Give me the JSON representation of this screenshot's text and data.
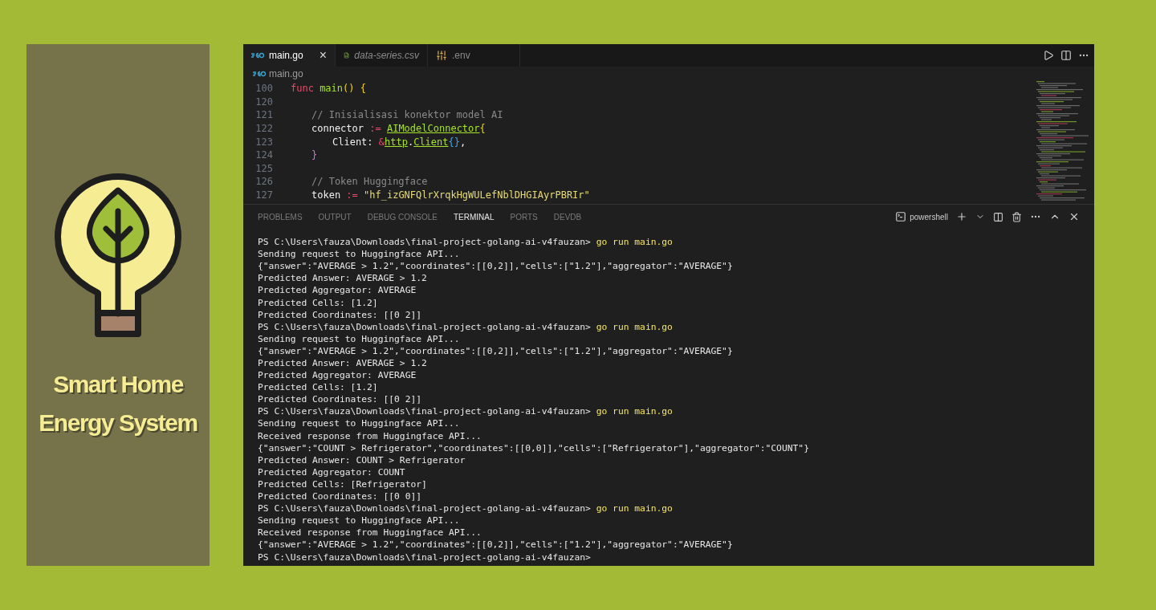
{
  "poster": {
    "title_lines": [
      "Smart Home",
      "Energy System"
    ]
  },
  "editor": {
    "tabs": [
      {
        "label": "main.go",
        "kind": "go",
        "selected": true,
        "italic": false,
        "close": "×"
      },
      {
        "label": "data-series.csv",
        "kind": "csv",
        "selected": false,
        "italic": true
      },
      {
        "label": ".env",
        "kind": "env",
        "selected": false,
        "italic": false
      }
    ],
    "breadcrumb": "main.go",
    "code_lines": [
      {
        "number": "100",
        "kind": "top",
        "tokens": [
          {
            "text": "func ",
            "kind": "keyword"
          },
          {
            "text": "main",
            "kind": "func"
          },
          {
            "text": "() {",
            "kind": "bracket"
          }
        ]
      },
      {
        "number": "120",
        "kind": "body"
      },
      {
        "number": "121",
        "kind": "body",
        "tokens": [
          {
            "text": "// Inisialisasi konektor model AI",
            "kind": "comment"
          }
        ]
      },
      {
        "number": "122",
        "kind": "body",
        "tokens": [
          {
            "text": "connector",
            "kind": "plain"
          },
          {
            "text": " := ",
            "kind": "op"
          },
          {
            "text": "AIModelConnector",
            "kind": "type"
          },
          {
            "text": "{",
            "kind": "bracket"
          }
        ]
      },
      {
        "number": "123",
        "kind": "inner",
        "tokens": [
          {
            "text": "Client: ",
            "kind": "plain"
          },
          {
            "text": "&",
            "kind": "op"
          },
          {
            "text": "http",
            "kind": "type"
          },
          {
            "text": ".",
            "kind": "plain"
          },
          {
            "text": "Client",
            "kind": "type"
          },
          {
            "text": "{}",
            "kind": "brace2"
          },
          {
            "text": ",",
            "kind": "plain"
          }
        ]
      },
      {
        "number": "124",
        "kind": "body",
        "tokens": [
          {
            "text": "}",
            "kind": "bracket3"
          }
        ]
      },
      {
        "number": "125",
        "kind": "body"
      },
      {
        "number": "126",
        "kind": "body",
        "tokens": [
          {
            "text": "// Token Huggingface",
            "kind": "comment"
          }
        ]
      },
      {
        "number": "127",
        "kind": "body",
        "tokens": [
          {
            "text": "token",
            "kind": "plain"
          },
          {
            "text": " := ",
            "kind": "op"
          },
          {
            "text": "\"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\"",
            "kind": "string"
          }
        ]
      }
    ]
  },
  "panel": {
    "tabs": [
      {
        "label": "PROBLEMS",
        "selected": false
      },
      {
        "label": "OUTPUT",
        "selected": false
      },
      {
        "label": "DEBUG CONSOLE",
        "selected": false
      },
      {
        "label": "TERMINAL",
        "selected": true
      },
      {
        "label": "PORTS",
        "selected": false
      },
      {
        "label": "DEVDB",
        "selected": false
      }
    ],
    "shell": "powershell",
    "terminal_lines": [
      {
        "kind": "prompt",
        "text": "PS C:\\Users\\fauza\\Downloads\\final-project-golang-ai-v4fauzan>",
        "command": "go run main.go"
      },
      {
        "kind": "output",
        "text": "Sending request to Huggingface API..."
      },
      {
        "kind": "output",
        "text": "{\"answer\":\"AVERAGE > 1.2\",\"coordinates\":[[0,2]],\"cells\":[\"1.2\"],\"aggregator\":\"AVERAGE\"}"
      },
      {
        "kind": "output",
        "text": "Predicted Answer: AVERAGE > 1.2"
      },
      {
        "kind": "output",
        "text": "Predicted Aggregator: AVERAGE"
      },
      {
        "kind": "output",
        "text": "Predicted Cells: [1.2]"
      },
      {
        "kind": "output",
        "text": "Predicted Coordinates: [[0 2]]"
      },
      {
        "kind": "prompt",
        "text": "PS C:\\Users\\fauza\\Downloads\\final-project-golang-ai-v4fauzan>",
        "command": "go run main.go"
      },
      {
        "kind": "output",
        "text": "Sending request to Huggingface API..."
      },
      {
        "kind": "output",
        "text": "{\"answer\":\"AVERAGE > 1.2\",\"coordinates\":[[0,2]],\"cells\":[\"1.2\"],\"aggregator\":\"AVERAGE\"}"
      },
      {
        "kind": "output",
        "text": "Predicted Answer: AVERAGE > 1.2"
      },
      {
        "kind": "output",
        "text": "Predicted Aggregator: AVERAGE"
      },
      {
        "kind": "output",
        "text": "Predicted Cells: [1.2]"
      },
      {
        "kind": "output",
        "text": "Predicted Coordinates: [[0 2]]"
      },
      {
        "kind": "prompt",
        "text": "PS C:\\Users\\fauza\\Downloads\\final-project-golang-ai-v4fauzan>",
        "command": "go run main.go"
      },
      {
        "kind": "output",
        "text": "Sending request to Huggingface API..."
      },
      {
        "kind": "output",
        "text": "Received response from Huggingface API..."
      },
      {
        "kind": "output",
        "text": "{\"answer\":\"COUNT > Refrigerator\",\"coordinates\":[[0,0]],\"cells\":[\"Refrigerator\"],\"aggregator\":\"COUNT\"}"
      },
      {
        "kind": "output",
        "text": "Predicted Answer: COUNT > Refrigerator"
      },
      {
        "kind": "output",
        "text": "Predicted Aggregator: COUNT"
      },
      {
        "kind": "output",
        "text": "Predicted Cells: [Refrigerator]"
      },
      {
        "kind": "output",
        "text": "Predicted Coordinates: [[0 0]]"
      },
      {
        "kind": "prompt",
        "text": "PS C:\\Users\\fauza\\Downloads\\final-project-golang-ai-v4fauzan>",
        "command": "go run main.go"
      },
      {
        "kind": "output",
        "text": "Sending request to Huggingface API..."
      },
      {
        "kind": "output",
        "text": "Received response from Huggingface API..."
      },
      {
        "kind": "output",
        "text": "{\"answer\":\"AVERAGE > 1.2\",\"coordinates\":[[0,2]],\"cells\":[\"1.2\"],\"aggregator\":\"AVERAGE\"}"
      },
      {
        "kind": "prompt",
        "text": "PS C:\\Users\\fauza\\Downloads\\final-project-golang-ai-v4fauzan>"
      }
    ]
  }
}
